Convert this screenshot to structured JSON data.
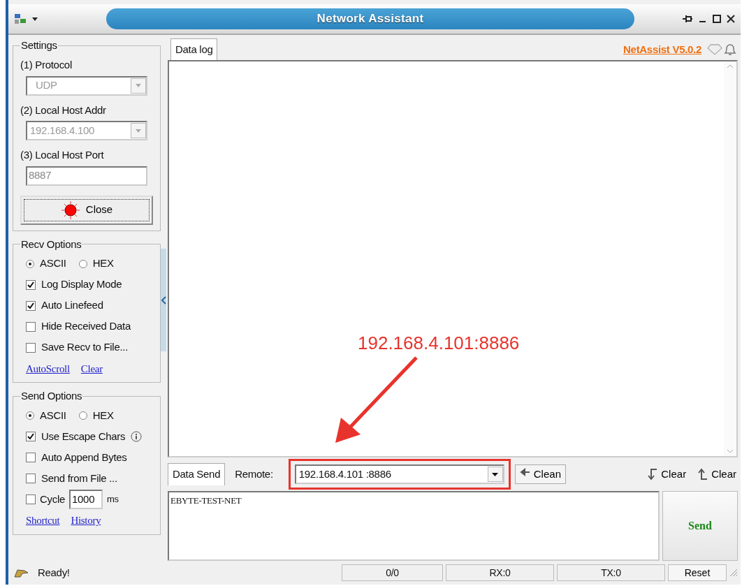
{
  "window": {
    "title": "Network Assistant"
  },
  "settings": {
    "legend": "Settings",
    "protocol_label": "(1) Protocol",
    "protocol": "UDP",
    "host_label": "(2) Local Host Addr",
    "host": "192.168.4.100",
    "port_label": "(3) Local Host Port",
    "port": "8887",
    "connect_button": "Close"
  },
  "recv_options": {
    "legend": "Recv Options",
    "modes": [
      {
        "label": "ASCII",
        "selected": true
      },
      {
        "label": "HEX",
        "selected": false
      }
    ],
    "checks": [
      {
        "label": "Log Display Mode",
        "checked": true
      },
      {
        "label": "Auto Linefeed",
        "checked": true
      },
      {
        "label": "Hide Received Data",
        "checked": false
      },
      {
        "label": "Save Recv to File...",
        "checked": false
      }
    ],
    "links": [
      "AutoScroll",
      "Clear"
    ]
  },
  "send_options": {
    "legend": "Send Options",
    "modes": [
      {
        "label": "ASCII",
        "selected": true
      },
      {
        "label": "HEX",
        "selected": false
      }
    ],
    "checks": [
      {
        "label": "Use Escape Chars",
        "checked": true,
        "info": true
      },
      {
        "label": "Auto Append Bytes",
        "checked": false
      },
      {
        "label": "Send from File ...",
        "checked": false
      }
    ],
    "cycle": {
      "label": "Cycle",
      "checked": false,
      "value": "1000",
      "unit": "ms"
    },
    "links": [
      "Shortcut",
      "History"
    ]
  },
  "log": {
    "tab": "Data log",
    "version": "NetAssist V5.0.2"
  },
  "send": {
    "tab": "Data Send",
    "remote_label": "Remote:",
    "remote": "192.168.4.101 :8886",
    "buttons": [
      "Clean",
      "Clear",
      "Clear"
    ],
    "message": "EBYTE-TEST-NET",
    "send_button": "Send"
  },
  "status_bar": {
    "message": "Ready!",
    "counts": "0/0",
    "rx": "RX:0",
    "tx": "TX:0",
    "reset": "Reset"
  },
  "annotation": {
    "label": "192.168.4.101:8886"
  }
}
